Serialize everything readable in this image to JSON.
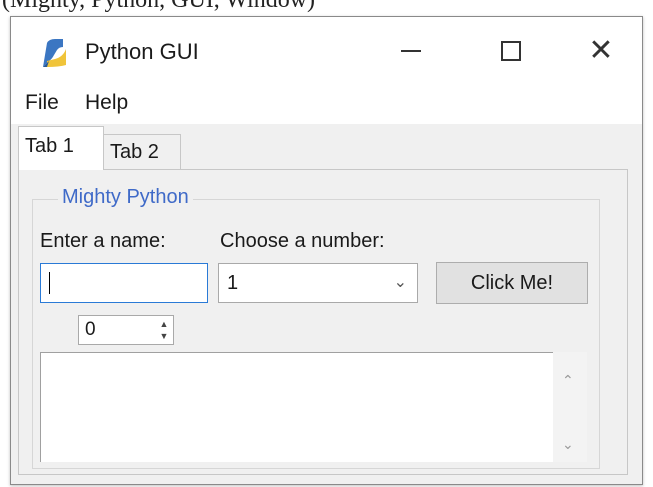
{
  "top_caption": "(Mighty, Python, GUI, Window)",
  "window": {
    "title": "Python GUI",
    "controls": {
      "minimize": "—",
      "maximize": "□",
      "close": "✕"
    }
  },
  "menu": {
    "items": [
      "File",
      "Help"
    ]
  },
  "tabs": [
    {
      "label": "Tab 1",
      "active": true
    },
    {
      "label": "Tab 2",
      "active": false
    }
  ],
  "group": {
    "title": "Mighty Python",
    "name_label": "Enter a name:",
    "number_label": "Choose a number:",
    "name_value": "",
    "number_value": "1",
    "button_label": "Click Me!",
    "spinbox_value": "0",
    "text_value": ""
  },
  "colors": {
    "group_title": "#3f6ac8",
    "focus_border": "#2a7ad6"
  },
  "icons": {
    "app": "python-feather-icon",
    "dropdown": "chevron-down-icon",
    "spin": "spin-arrows-icon",
    "scroll_up": "scroll-up-icon",
    "scroll_down": "scroll-down-icon"
  }
}
